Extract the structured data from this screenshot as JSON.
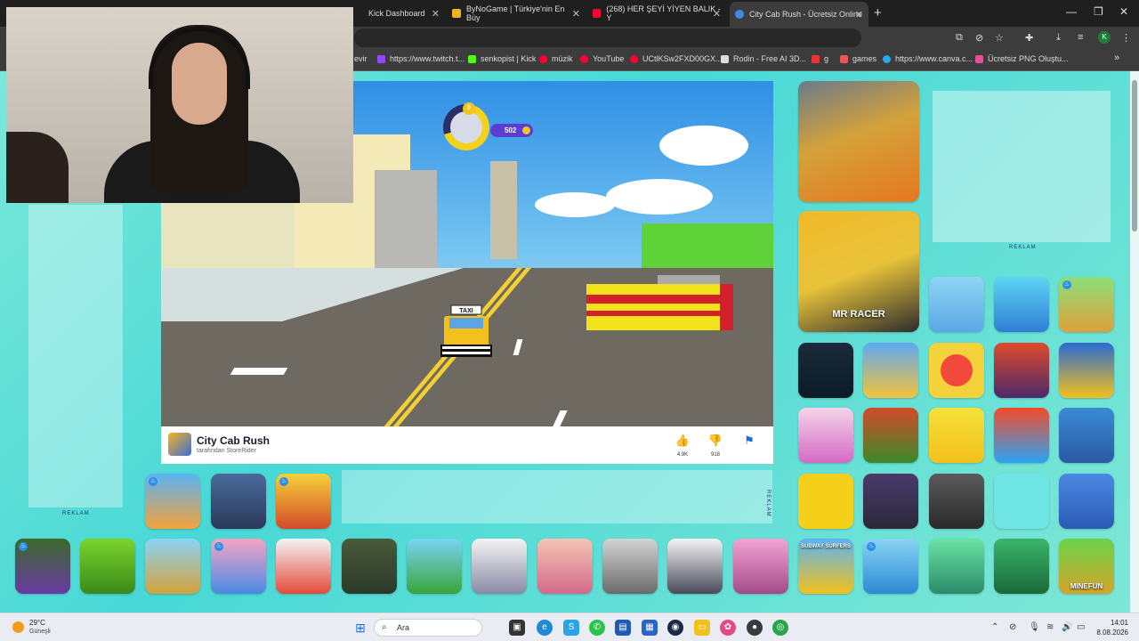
{
  "browser": {
    "tabs": [
      {
        "title": "Kick Dashboard",
        "fav_color": "#53fc18"
      },
      {
        "title": "ByNoGame | Türkiye'nin En Büy",
        "fav_color": "#f4b223"
      },
      {
        "title": "(268) HER ŞEYİ YİYEN BALIK - Y",
        "fav_color": "#ff0033"
      },
      {
        "title": "City Cab Rush - Ücretsiz Online",
        "fav_color": "#3b8ee8",
        "active": true
      }
    ],
    "new_tab_glyph": "+",
    "bookmarks": [
      {
        "label": "evir",
        "fav_color": "#bbb"
      },
      {
        "label": "https://www.twitch.t...",
        "fav_color": "#9146ff"
      },
      {
        "label": "senkopist | Kick",
        "fav_color": "#53fc18"
      },
      {
        "label": "müzik",
        "fav_color": "#ff0033"
      },
      {
        "label": "YouTube",
        "fav_color": "#ff0033"
      },
      {
        "label": "UCtlKSw2FXD00GX...",
        "fav_color": "#ff0033"
      },
      {
        "label": "Rodin - Free AI 3D...",
        "fav_color": "#ddd"
      },
      {
        "label": "g",
        "fav_color": "#e33"
      },
      {
        "label": "games",
        "fav_color": "#e55"
      },
      {
        "label": "https://www.canva.c...",
        "fav_color": "#2aa7f1"
      },
      {
        "label": "Ücretsiz PNG Oluştu...",
        "fav_color": "#e64d9b"
      }
    ],
    "profile_initial": "K"
  },
  "game": {
    "title": "City Cab Rush",
    "author": "tarafından StoreRider",
    "likes": "4.9K",
    "dislikes": "918",
    "hud_level": "0",
    "coins": "502",
    "sign": "TAXI"
  },
  "ads": {
    "left_label": "REKLAM",
    "right_label": "REKLAM",
    "mid_label": "REKLAM"
  },
  "tiles": {
    "big": [
      {
        "name": "police-chase-tile",
        "label": ""
      },
      {
        "name": "mr-racer-tile",
        "label": "MR RACER"
      }
    ],
    "side": [
      {
        "name": "tile-1",
        "label": ""
      },
      {
        "name": "tile-2",
        "label": ""
      },
      {
        "name": "tile-3",
        "label": ""
      },
      {
        "name": "tile-4",
        "label": ""
      },
      {
        "name": "tile-5",
        "label": ""
      },
      {
        "name": "tile-6",
        "label": ""
      },
      {
        "name": "tile-7",
        "label": ""
      },
      {
        "name": "tile-8",
        "label": ""
      },
      {
        "name": "tile-9",
        "label": ""
      },
      {
        "name": "tile-10",
        "label": ""
      },
      {
        "name": "tile-11",
        "label": ""
      },
      {
        "name": "tile-12",
        "label": ""
      },
      {
        "name": "tile-13",
        "label": ""
      },
      {
        "name": "tile-14",
        "label": ""
      },
      {
        "name": "tile-15",
        "label": ""
      },
      {
        "name": "tile-16",
        "label": ""
      },
      {
        "name": "tile-17",
        "label": ""
      },
      {
        "name": "tile-18",
        "label": ""
      },
      {
        "name": "tile-19",
        "label": ""
      },
      {
        "name": "tile-20",
        "label": ""
      },
      {
        "name": "tile-21",
        "label": ""
      },
      {
        "name": "tile-22",
        "label": ""
      },
      {
        "name": "tile-23",
        "label": ""
      }
    ],
    "bottom_label_subway": "SUBWAY SURFERS",
    "bottom_label_minefun": "MINEFUN"
  },
  "taskbar": {
    "temperature": "29°C",
    "weather": "Güneşli",
    "search_placeholder": "Ara",
    "time": "14:01",
    "date": "8.08.2026"
  }
}
